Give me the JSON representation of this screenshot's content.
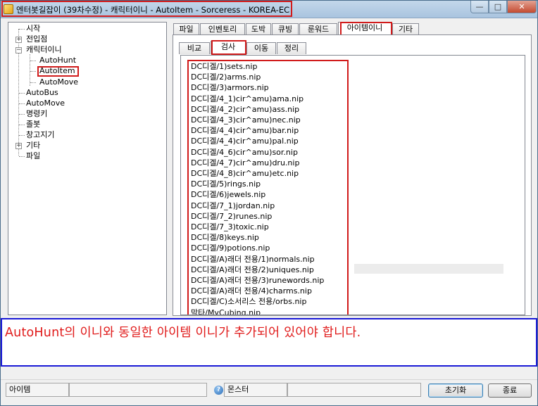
{
  "window": {
    "title": "엔터봇길잡이 (39차수정) - 캐릭터이니 - AutoItem - Sorceress - KOREA-EC",
    "minimize_glyph": "—",
    "maximize_glyph": "□",
    "close_glyph": "✕"
  },
  "tree": {
    "items": [
      {
        "label": "시작"
      },
      {
        "label": "전입점"
      },
      {
        "label": "캐릭터이니"
      },
      {
        "label": "AutoHunt"
      },
      {
        "label": "AutoItem"
      },
      {
        "label": "AutoMove"
      },
      {
        "label": "AutoBus"
      },
      {
        "label": "AutoMove"
      },
      {
        "label": "명령키"
      },
      {
        "label": "졸봇"
      },
      {
        "label": "창고지기"
      },
      {
        "label": "기타"
      },
      {
        "label": "파일"
      }
    ],
    "selected": "AutoItem"
  },
  "main_tabs": {
    "items": [
      {
        "label": "파일"
      },
      {
        "label": "인벤토리"
      },
      {
        "label": "도박"
      },
      {
        "label": "큐빙"
      },
      {
        "label": "룬워드"
      },
      {
        "label": "아이템이니"
      },
      {
        "label": "기타"
      }
    ],
    "active": "아이템이니"
  },
  "sub_tabs": {
    "items": [
      {
        "label": "비교"
      },
      {
        "label": "검사"
      },
      {
        "label": "이동"
      },
      {
        "label": "정리"
      }
    ],
    "active": "검사"
  },
  "file_list": [
    "DC디겔/1)sets.nip",
    "DC디겔/2)arms.nip",
    "DC디겔/3)armors.nip",
    "DC디겔/4_1)cir^amu)ama.nip",
    "DC디겔/4_2)cir^amu)ass.nip",
    "DC디겔/4_3)cir^amu)nec.nip",
    "DC디겔/4_4)cir^amu)bar.nip",
    "DC디겔/4_4)cir^amu)pal.nip",
    "DC디겔/4_6)cir^amu)sor.nip",
    "DC디겔/4_7)cir^amu)dru.nip",
    "DC디겔/4_8)cir^amu)etc.nip",
    "DC디겔/5)rings.nip",
    "DC디겔/6)jewels.nip",
    "DC디겔/7_1)jordan.nip",
    "DC디겔/7_2)runes.nip",
    "DC디겔/7_3)toxic.nip",
    "DC디겔/8)keys.nip",
    "DC디겔/9)potions.nip",
    "DC디겔/A)래더 전용/1)normals.nip",
    "DC디겔/A)래더 전용/2)uniques.nip",
    "DC디겔/A)래더 전용/3)runewords.nip",
    "DC디겔/A)래더 전용/4)charms.nip",
    "DC디겔/C)소서리스 전용/orbs.nip",
    "막타/MyCubing.nip"
  ],
  "note": {
    "text": "AutoHunt의 이니와 동일한 아이템 이니가 추가되어 있어야 합니다."
  },
  "statusbar": {
    "item_label": "아이템",
    "item_value": "",
    "help_glyph": "?",
    "monster_label": "몬스터",
    "monster_value": "",
    "reset_button": "초기화",
    "exit_button": "종료"
  },
  "colors": {
    "highlight_red": "#d11b1b",
    "note_border_blue": "#1a19d6",
    "note_text_red": "#e01a1a"
  }
}
